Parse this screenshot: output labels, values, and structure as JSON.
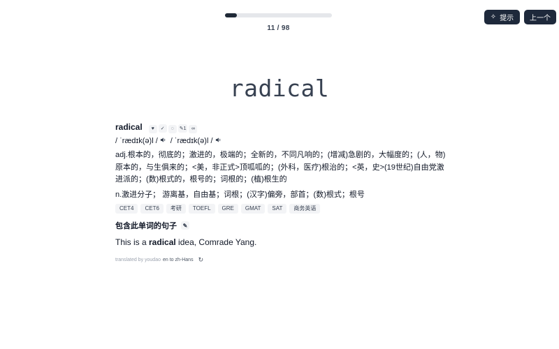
{
  "progress": {
    "current": 11,
    "total": 98,
    "fraction": 0.112,
    "label": "11 / 98"
  },
  "buttons": {
    "hint_icon": "sparkle-icon",
    "hint_label": "提示",
    "prev_label": "上一个"
  },
  "card": {
    "word": "radical"
  },
  "detail": {
    "headword": "radical",
    "actions": [
      {
        "name": "heart-icon",
        "glyph": "♥"
      },
      {
        "name": "check-double-icon",
        "glyph": "✓"
      },
      {
        "name": "chat-bubble-icon",
        "glyph": "◌"
      },
      {
        "name": "pencil-count-icon",
        "glyph": "✎1"
      },
      {
        "name": "link-icon",
        "glyph": "∞"
      }
    ],
    "phonetic_uk": "/ ˈrædɪk(ə)l /",
    "phonetic_us": "/ ˈrædɪk(ə)l /",
    "definitions": [
      "adj.根本的，彻底的；激进的，极端的；全新的，不同凡响的；(增减)急剧的，大幅度的；(人，物)原本的，与生俱来的；<美，非正式>顶呱呱的；(外科，医疗)根治的；<英，史>(19世纪)自由党激进派的；(数)根式的，根号的；词根的；(植)根生的",
      "n.激进分子； 游离基，自由基；词根；(汉字)偏旁，部首；(数)根式；根号"
    ],
    "tags": [
      "CET4",
      "CET6",
      "考研",
      "TOEFL",
      "GRE",
      "GMAT",
      "SAT",
      "商务英语"
    ],
    "sentences_heading": "包含此单词的句子",
    "sentence": {
      "before": "This is a ",
      "highlight": "radical",
      "after": " idea, Comrade Yang."
    },
    "credit": {
      "prefix": "translated by youdao",
      "lang": "en to zh-Hans"
    }
  }
}
